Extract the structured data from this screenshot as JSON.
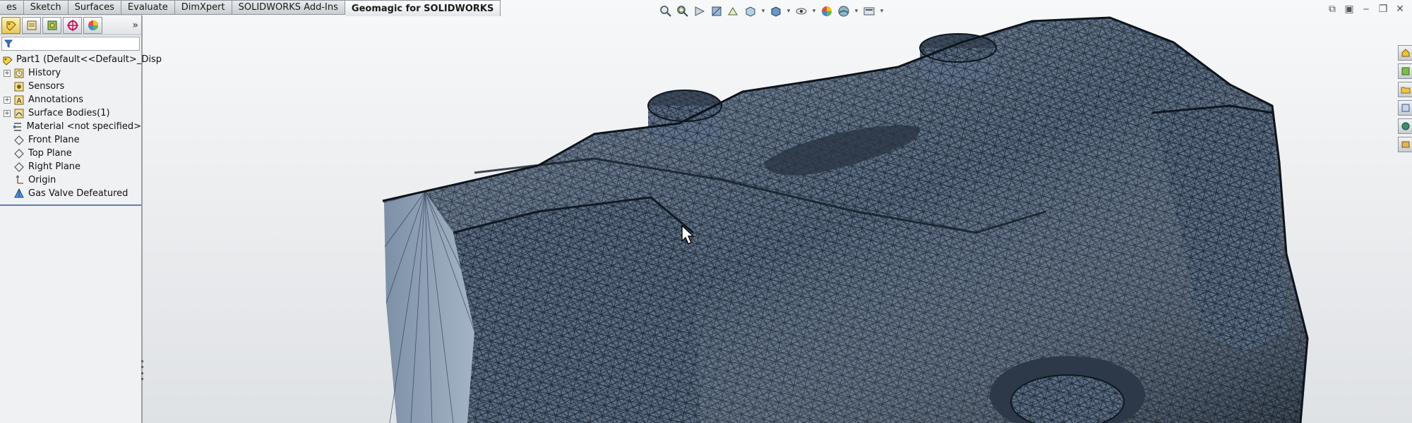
{
  "tabs": [
    {
      "label": "es",
      "active": false
    },
    {
      "label": "Sketch",
      "active": false
    },
    {
      "label": "Surfaces",
      "active": false
    },
    {
      "label": "Evaluate",
      "active": false
    },
    {
      "label": "DimXpert",
      "active": false
    },
    {
      "label": "SOLIDWORKS Add-Ins",
      "active": false
    },
    {
      "label": "Geomagic for SOLIDWORKS",
      "active": true
    }
  ],
  "feature_manager": {
    "tools": [
      "feature-manager-icon",
      "property-manager-icon",
      "configuration-manager-icon",
      "dimxpert-manager-icon",
      "display-manager-icon"
    ],
    "expand_glyph": "»",
    "root": {
      "label": "Part1  (Default<<Default>_Disp",
      "icon": "part-icon"
    },
    "items": [
      {
        "label": "History",
        "icon": "history-icon",
        "expandable": true
      },
      {
        "label": "Sensors",
        "icon": "sensors-icon",
        "expandable": false
      },
      {
        "label": "Annotations",
        "icon": "annotations-icon",
        "expandable": true
      },
      {
        "label": "Surface Bodies(1)",
        "icon": "surface-bodies-icon",
        "expandable": true
      },
      {
        "label": "Material <not specified>",
        "icon": "material-icon",
        "expandable": false
      },
      {
        "label": "Front Plane",
        "icon": "plane-icon",
        "expandable": false
      },
      {
        "label": "Top Plane",
        "icon": "plane-icon",
        "expandable": false
      },
      {
        "label": "Right Plane",
        "icon": "plane-icon",
        "expandable": false
      },
      {
        "label": "Origin",
        "icon": "origin-icon",
        "expandable": false
      },
      {
        "label": "Gas Valve Defeatured",
        "icon": "mesh-feature-icon",
        "expandable": false
      }
    ]
  },
  "view_toolbar": {
    "buttons": [
      "zoom-to-fit-icon",
      "zoom-to-area-icon",
      "previous-view-icon",
      "section-view-icon",
      "dynamic-annotation-icon",
      "view-orientation-icon",
      "display-style-icon",
      "hide-show-items-icon",
      "edit-appearance-icon",
      "apply-scene-icon",
      "view-settings-icon"
    ]
  },
  "colors": {
    "mesh_fill": "#5b6e84",
    "mesh_dark": "#1d2633",
    "cap_face": "#8a9db4",
    "tab_active": "#ffffff",
    "selection_line": "#5a7fb0"
  }
}
